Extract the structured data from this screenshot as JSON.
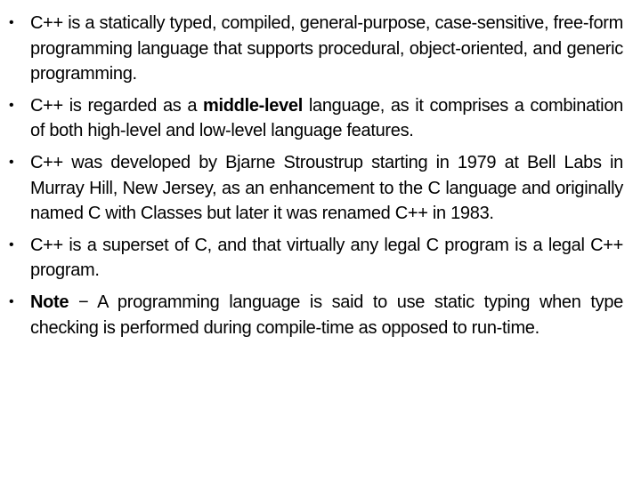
{
  "bullet_glyph": "•",
  "bullets": [
    {
      "segments": [
        {
          "text": "C++ is a statically typed, compiled, general-purpose, case-sensitive, free-form programming language that supports procedural, object-oriented, and generic programming.",
          "bold": false
        }
      ]
    },
    {
      "segments": [
        {
          "text": "C++ is regarded as a ",
          "bold": false
        },
        {
          "text": "middle-level",
          "bold": true
        },
        {
          "text": " language, as it comprises a combination of both high-level and low-level language features.",
          "bold": false
        }
      ]
    },
    {
      "segments": [
        {
          "text": "C++ was developed by Bjarne Stroustrup starting in 1979 at Bell Labs in Murray Hill, New Jersey, as an enhancement to the C language and originally named C with Classes but later it was renamed C++ in 1983.",
          "bold": false
        }
      ]
    },
    {
      "segments": [
        {
          "text": "C++ is a superset of C, and that virtually any legal C program is a legal C++ program.",
          "bold": false
        }
      ]
    },
    {
      "segments": [
        {
          "text": "Note",
          "bold": true
        },
        {
          "text": " − A programming language is said to use static typing when type checking is performed during compile-time as opposed to run-time.",
          "bold": false
        }
      ]
    }
  ]
}
